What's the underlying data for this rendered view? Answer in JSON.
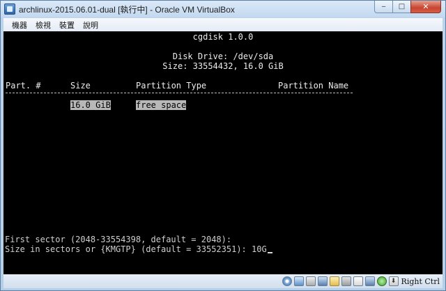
{
  "window": {
    "title": "archlinux-2015.06.01-dual [執行中] - Oracle VM VirtualBox",
    "minimize_glyph": "‒",
    "maximize_glyph": "□",
    "close_glyph": "✕"
  },
  "menu": {
    "items": [
      "機器",
      "檢視",
      "裝置",
      "說明"
    ]
  },
  "terminal": {
    "program_title": "cgdisk 1.0.0",
    "disk_drive": "Disk Drive: /dev/sda",
    "disk_size": "Size: 33554432, 16.0 GiB",
    "headers": {
      "part": "Part. #",
      "size": "Size",
      "type": "Partition Type",
      "name": "Partition Name"
    },
    "rows": [
      {
        "size": "16.0 GiB",
        "type": "free space"
      }
    ],
    "prompt_first_sector": "First sector (2048-33554398, default = 2048):",
    "prompt_size": "Size in sectors or {KMGTP} (default = 33552351): ",
    "input_value": "10G"
  },
  "statusbar": {
    "host_key": "Right Ctrl",
    "icons": [
      "hard-disk-icon",
      "optical-drive-icon",
      "usb-icon",
      "shared-folder-icon",
      "network-icon",
      "display-icon",
      "video-capture-icon",
      "mouse-integration-icon",
      "keyboard-capture-icon"
    ]
  }
}
